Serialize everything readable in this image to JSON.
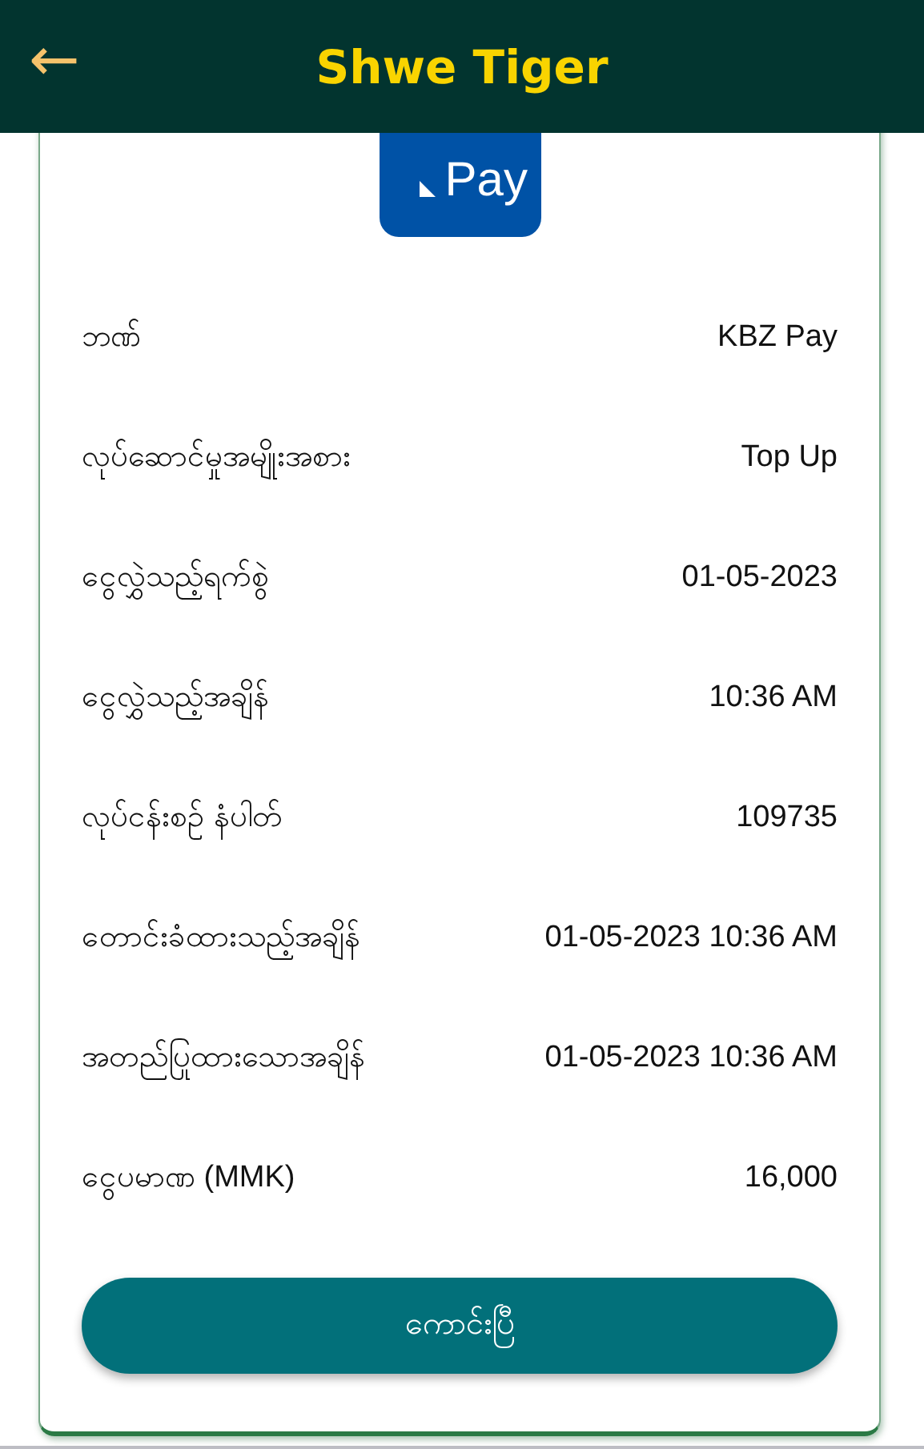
{
  "header": {
    "back": "←",
    "title": "Shwe Tiger"
  },
  "logo": {
    "text": "Pay"
  },
  "details": [
    {
      "label": "ဘဏ်",
      "value": "KBZ Pay"
    },
    {
      "label": "လုပ်ဆောင်မှုအမျိုးအစား",
      "value": "Top Up"
    },
    {
      "label": "ငွေလွှဲသည့်ရက်စွဲ",
      "value": "01-05-2023"
    },
    {
      "label": "ငွေလွှဲသည့်အချိန်",
      "value": "10:36 AM"
    },
    {
      "label": "လုပ်ငန်းစဉ် နံပါတ်",
      "value": "109735"
    },
    {
      "label": "တောင်းခံထားသည့်အချိန်",
      "value": "01-05-2023 10:36 AM"
    },
    {
      "label": "အတည်ပြုထားသောအချိန်",
      "value": "01-05-2023 10:36 AM"
    },
    {
      "label": "ငွေပမာဏ (MMK)",
      "value": "16,000"
    }
  ],
  "button": "ကောင်းပြီ"
}
